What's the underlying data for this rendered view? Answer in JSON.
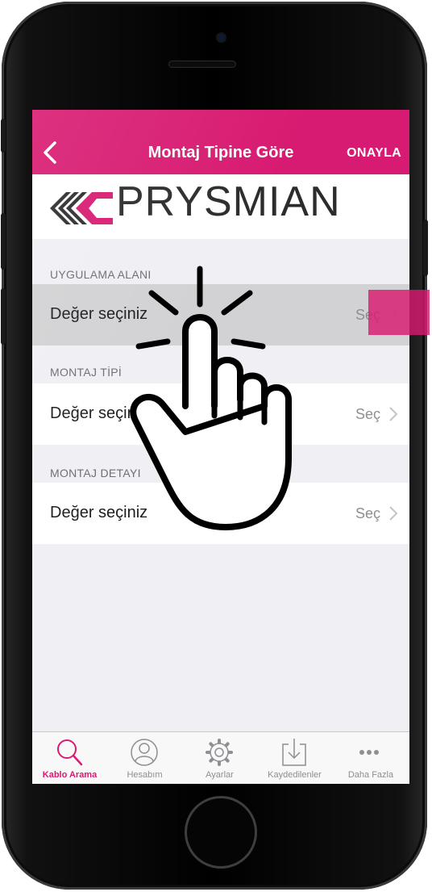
{
  "navbar": {
    "title": "Montaj Tipine Göre",
    "confirm_label": "ONAYLA",
    "background_color": "#d81b72"
  },
  "brand": {
    "logo_text": "PRYSMIAN",
    "logo_icon": "prysmian-logo-icon"
  },
  "sections": [
    {
      "header": "UYGULAMA ALANI",
      "value_label": "Değer seçiniz",
      "action_label": "Seç",
      "pressed": true
    },
    {
      "header": "MONTAJ TİPİ",
      "value_label": "Değer seçiniz",
      "action_label": "Seç",
      "pressed": false
    },
    {
      "header": "MONTAJ DETAYI",
      "value_label": "Değer seçiniz",
      "action_label": "Seç",
      "pressed": false
    }
  ],
  "tabbar": {
    "accent_color": "#d81b72",
    "tabs": [
      {
        "label": "Kablo Arama",
        "icon": "search-icon",
        "active": true
      },
      {
        "label": "Hesabım",
        "icon": "user-icon",
        "active": false
      },
      {
        "label": "Ayarlar",
        "icon": "gear-icon",
        "active": false
      },
      {
        "label": "Kaydedilenler",
        "icon": "download-icon",
        "active": false
      },
      {
        "label": "Daha Fazla",
        "icon": "more-icon",
        "active": false
      }
    ]
  },
  "overlay": {
    "gesture_icon": "tap-hand-icon"
  }
}
